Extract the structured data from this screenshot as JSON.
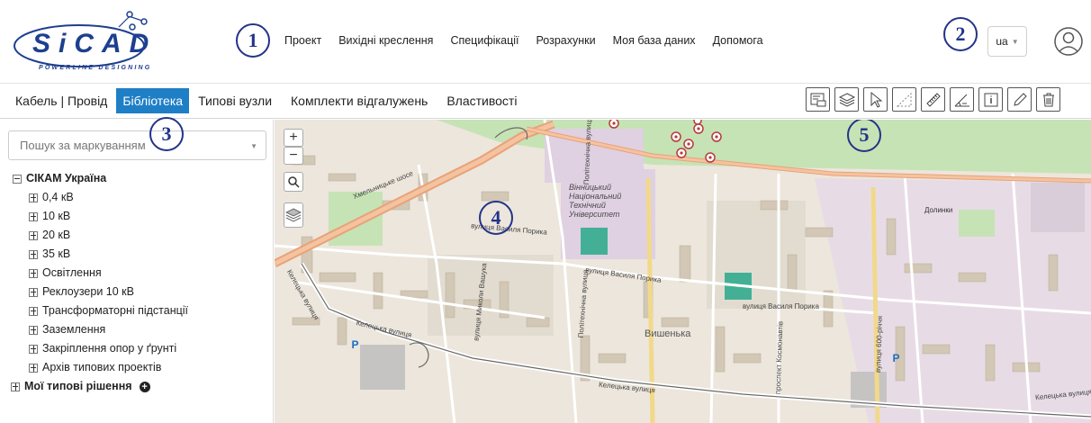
{
  "header": {
    "logo_text": "SiCAD",
    "logo_subtitle": "POWERLINE DESIGNING",
    "nav": [
      "Проект",
      "Вихідні креслення",
      "Специфікації",
      "Розрахунки",
      "Моя база даних",
      "Допомога"
    ],
    "language": "ua"
  },
  "callouts": [
    "1",
    "2",
    "3",
    "4",
    "5"
  ],
  "subbar": {
    "tabs": [
      "Кабель | Провід",
      "Бібліотека",
      "Типові вузли",
      "Комплекти відгалужень",
      "Властивості"
    ],
    "active_tab": "Бібліотека",
    "tools": [
      "tkpu-icon",
      "layers-icon",
      "pointer-icon",
      "polygon-select-icon",
      "ruler-icon",
      "angle-measure-icon",
      "info-icon",
      "pencil-icon",
      "trash-icon"
    ]
  },
  "sidebar": {
    "search_placeholder": "Пошук за маркуванням",
    "root": "СІКАМ Україна",
    "items": [
      "0,4 кВ",
      "10 кВ",
      "20 кВ",
      "35 кВ",
      "Освітлення",
      "Реклоузери 10 кВ",
      "Трансформаторні підстанції",
      "Заземлення",
      "Закріплення опор у ґрунті",
      "Архів типових проектів"
    ],
    "second_root": "Мої типові рішення"
  },
  "map": {
    "university_label": [
      "Вінницький",
      "Національний",
      "Технічний",
      "Університет"
    ],
    "district_label": "Вишенька",
    "area_label": "Долинки",
    "street_labels": [
      "вулиця Василя Порика",
      "вулиця Василя Порика",
      "вулиця Василя Порика",
      "Келецька вулиця",
      "Келецька вулиця",
      "Келецька вулиця",
      "Келецька вулиця",
      "Хмельницьке шосе",
      "Політехнічна вулиця",
      "вулиця Миколи Вашука",
      "Політехнічна вулиця",
      "вулиця 600-річчя",
      "проспект Космонавтів"
    ],
    "parking": "P",
    "zoom_in": "+",
    "zoom_out": "−"
  }
}
